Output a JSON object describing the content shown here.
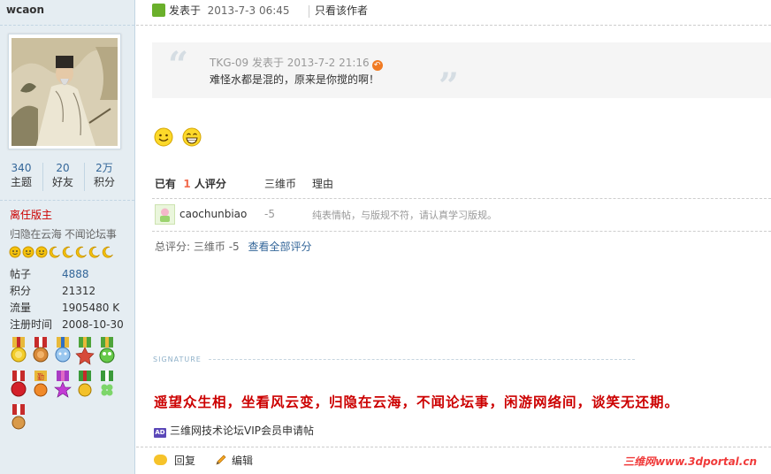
{
  "sidebar": {
    "username": "wcaon",
    "stats": [
      {
        "num": "340",
        "label": "主题"
      },
      {
        "num": "20",
        "label": "好友"
      },
      {
        "num": "2万",
        "label": "积分"
      }
    ],
    "role": "离任版主",
    "motto": "归隐在云海 不闻论坛事",
    "info": [
      {
        "key": "帖子",
        "value": "4888"
      },
      {
        "key": "积分",
        "value": "21312"
      },
      {
        "key": "流量",
        "value": "1905480 K"
      },
      {
        "key": "注册时间",
        "value": "2008-10-30"
      }
    ]
  },
  "post": {
    "posted_prefix": "发表于",
    "posted_time": "2013-7-3 06:45",
    "only_author": "只看该作者",
    "quote": {
      "author": "TKG-09",
      "posted_prefix": "发表于",
      "time": "2013-7-2 21:16",
      "text": "难怪水都是混的，原来是你搅的啊！"
    }
  },
  "rating": {
    "head_prefix": "已有",
    "head_count": "1",
    "head_suffix": "人评分",
    "col_currency": "三维币",
    "col_reason": "理由",
    "rows": [
      {
        "name": "caochunbiao",
        "score": "-5",
        "reason": "纯表情帖，与版规不符，请认真学习版规。"
      }
    ],
    "total_label": "总评分:",
    "total_currency": "三维币",
    "total_value": "-5",
    "view_all": "查看全部评分"
  },
  "signature": {
    "label": "SIGNATURE",
    "text": "遥望众生相，坐看风云变，归隐在云海，不闻论坛事，闲游网络间，谈笑无还期。",
    "ad_badge": "AD",
    "ad_link": "三维网技术论坛VIP会员申请帖"
  },
  "footer": {
    "reply": "回复",
    "edit": "编辑",
    "watermark": "三维网www.3dportal.cn"
  }
}
